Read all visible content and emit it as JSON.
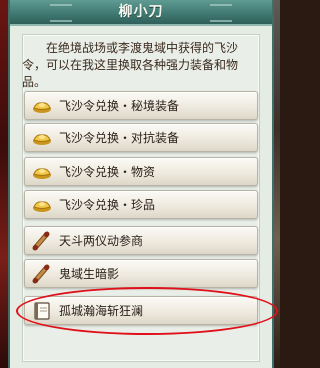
{
  "window": {
    "title": "柳小刀"
  },
  "dialog": {
    "description": "在绝境战场或李渡鬼域中获得的飞沙令，可以在我这里换取各种强力装备和物品。"
  },
  "options": [
    {
      "label": "飞沙令兑换・秘境装备",
      "icon": "gold-ingot-icon"
    },
    {
      "label": "飞沙令兑换・对抗装备",
      "icon": "gold-ingot-icon"
    },
    {
      "label": "飞沙令兑换・物资",
      "icon": "gold-ingot-icon"
    },
    {
      "label": "飞沙令兑换・珍品",
      "icon": "gold-ingot-icon"
    },
    {
      "label": "天斗两仪动参商",
      "icon": "scroll-icon"
    },
    {
      "label": "鬼域生暗影",
      "icon": "scroll-icon"
    },
    {
      "label": "孤城瀚海斩狂澜",
      "icon": "book-icon"
    }
  ],
  "colors": {
    "title_bar": "#417a73",
    "panel": "#e5ece4",
    "highlight": "#e0101a"
  }
}
